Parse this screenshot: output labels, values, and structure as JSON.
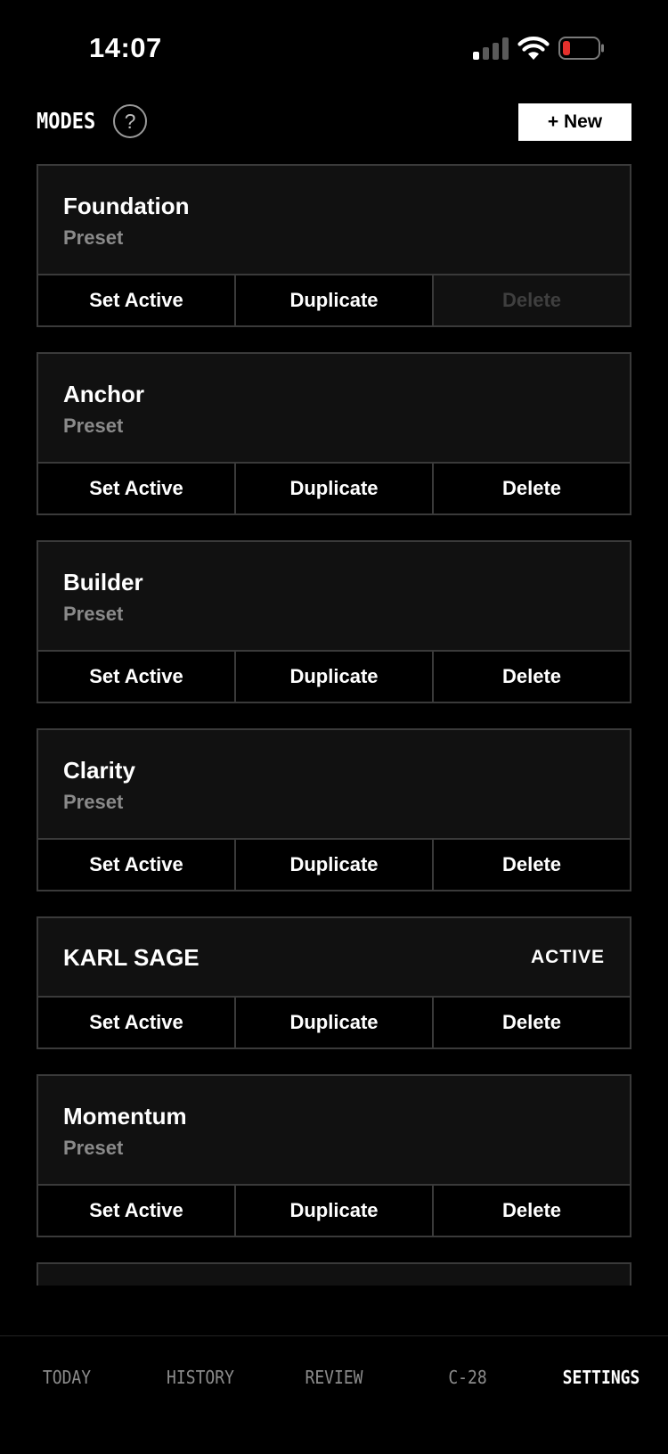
{
  "status_bar": {
    "time": "14:07",
    "icons": [
      "cellular-signal-icon",
      "wifi-icon",
      "battery-low-icon"
    ],
    "battery_color": "#e5302c"
  },
  "header": {
    "title": "MODES",
    "help_label": "?",
    "new_button_label": "+ New"
  },
  "modes": [
    {
      "name": "Foundation",
      "subtitle": "Preset",
      "active": false,
      "actions": [
        "Set Active",
        "Duplicate",
        "Delete"
      ],
      "delete_disabled": true
    },
    {
      "name": "Anchor",
      "subtitle": "Preset",
      "active": false,
      "actions": [
        "Set Active",
        "Duplicate",
        "Delete"
      ],
      "delete_disabled": false
    },
    {
      "name": "Builder",
      "subtitle": "Preset",
      "active": false,
      "actions": [
        "Set Active",
        "Duplicate",
        "Delete"
      ],
      "delete_disabled": false
    },
    {
      "name": "Clarity",
      "subtitle": "Preset",
      "active": false,
      "actions": [
        "Set Active",
        "Duplicate",
        "Delete"
      ],
      "delete_disabled": false
    },
    {
      "name": "KARL SAGE",
      "subtitle": "",
      "active": true,
      "active_label": "ACTIVE",
      "actions": [
        "Set Active",
        "Duplicate",
        "Delete"
      ],
      "delete_disabled": false
    },
    {
      "name": "Momentum",
      "subtitle": "Preset",
      "active": false,
      "actions": [
        "Set Active",
        "Duplicate",
        "Delete"
      ],
      "delete_disabled": false
    }
  ],
  "bottom_nav": {
    "items": [
      "TODAY",
      "HISTORY",
      "REVIEW",
      "C-28",
      "SETTINGS"
    ],
    "active_index": 4
  }
}
